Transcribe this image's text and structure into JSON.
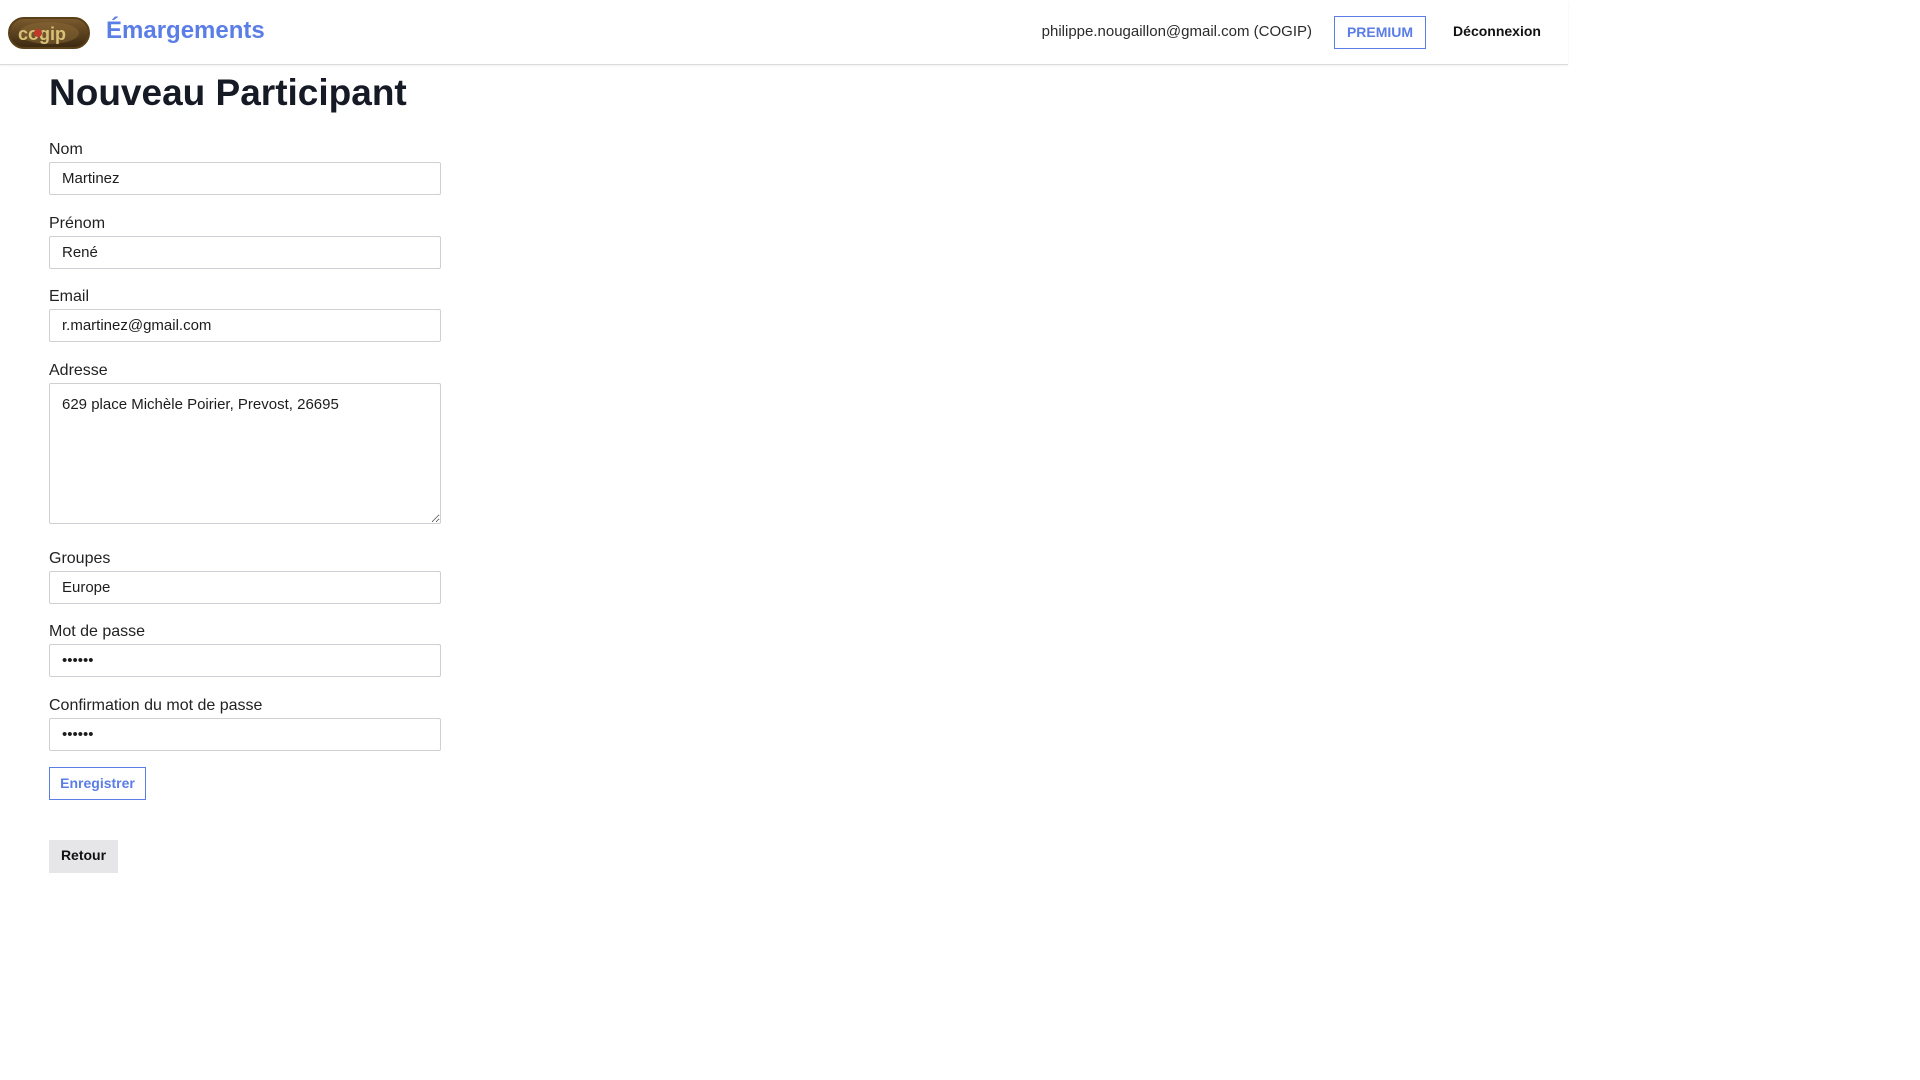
{
  "header": {
    "logo_text": "cogip",
    "app_title": "Émargements",
    "user_email": "philippe.nougaillon@gmail.com (COGIP)",
    "premium_label": "PREMIUM",
    "logout_label": "Déconnexion",
    "accent_color": "#5b7de6"
  },
  "page": {
    "title": "Nouveau Participant"
  },
  "form": {
    "nom": {
      "label": "Nom",
      "value": "Martinez"
    },
    "prenom": {
      "label": "Prénom",
      "value": "René"
    },
    "email": {
      "label": "Email",
      "value": "r.martinez@gmail.com"
    },
    "adresse": {
      "label": "Adresse",
      "value": "629 place Michèle Poirier, Prevost, 26695"
    },
    "groupes": {
      "label": "Groupes",
      "value": "Europe"
    },
    "mot_de_passe": {
      "label": "Mot de passe",
      "value": "••••••"
    },
    "confirmation": {
      "label": "Confirmation du mot de passe",
      "value": "••••••"
    },
    "save_label": "Enregistrer"
  },
  "footer": {
    "back_label": "Retour"
  }
}
